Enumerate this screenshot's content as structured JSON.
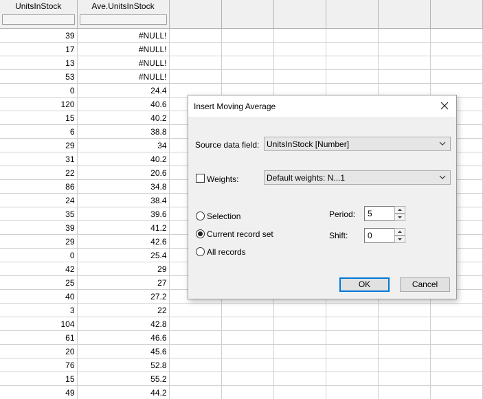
{
  "grid": {
    "columns": [
      "UnitsInStock",
      "Ave.UnitsInStock",
      "",
      "",
      "",
      "",
      "",
      "",
      ""
    ],
    "rows": [
      [
        "39",
        "#NULL!"
      ],
      [
        "17",
        "#NULL!"
      ],
      [
        "13",
        "#NULL!"
      ],
      [
        "53",
        "#NULL!"
      ],
      [
        "0",
        "24.4"
      ],
      [
        "120",
        "40.6"
      ],
      [
        "15",
        "40.2"
      ],
      [
        "6",
        "38.8"
      ],
      [
        "29",
        "34"
      ],
      [
        "31",
        "40.2"
      ],
      [
        "22",
        "20.6"
      ],
      [
        "86",
        "34.8"
      ],
      [
        "24",
        "38.4"
      ],
      [
        "35",
        "39.6"
      ],
      [
        "39",
        "41.2"
      ],
      [
        "29",
        "42.6"
      ],
      [
        "0",
        "25.4"
      ],
      [
        "42",
        "29"
      ],
      [
        "25",
        "27"
      ],
      [
        "40",
        "27.2"
      ],
      [
        "3",
        "22"
      ],
      [
        "104",
        "42.8"
      ],
      [
        "61",
        "46.6"
      ],
      [
        "20",
        "45.6"
      ],
      [
        "76",
        "52.8"
      ],
      [
        "15",
        "55.2"
      ],
      [
        "49",
        "44.2"
      ]
    ]
  },
  "dialog": {
    "title": "Insert Moving Average",
    "source_label": "Source data field:",
    "source_value": "UnitsInStock  [Number]",
    "weights_label": "Weights:",
    "weights_checked": false,
    "weights_value": "Default weights: N...1",
    "scope_options": [
      {
        "label": "Selection",
        "checked": false
      },
      {
        "label": "Current record set",
        "checked": true
      },
      {
        "label": "All records",
        "checked": false
      }
    ],
    "period_label": "Period:",
    "period_value": "5",
    "shift_label": "Shift:",
    "shift_value": "0",
    "ok_label": "OK",
    "cancel_label": "Cancel"
  }
}
